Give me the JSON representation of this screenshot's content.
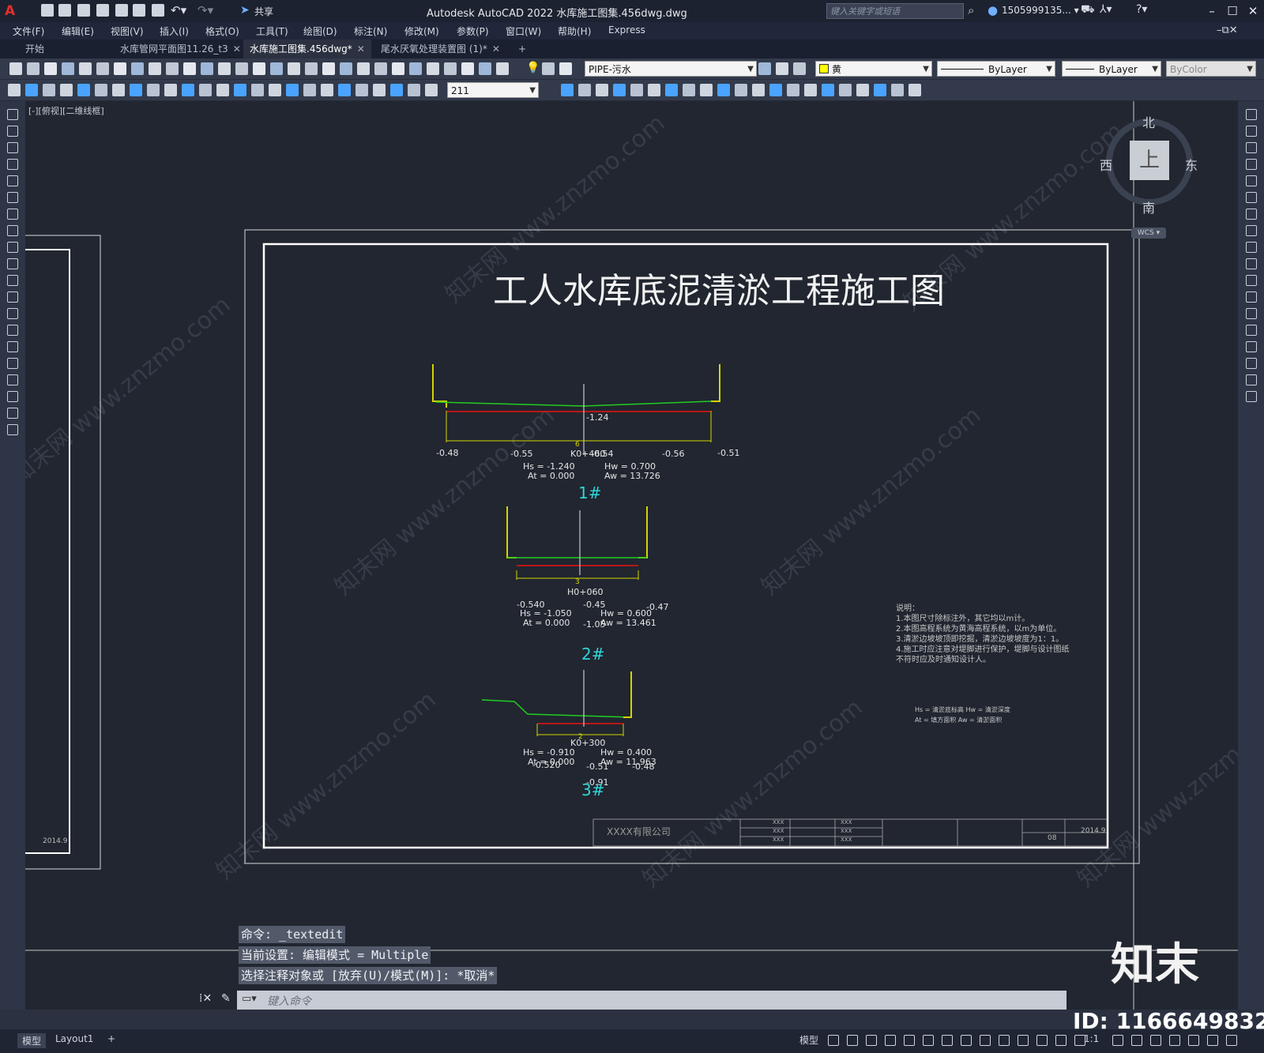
{
  "titlebar": {
    "title": "Autodesk AutoCAD 2022    水库施工图集.456dwg.dwg",
    "share": "共享",
    "search_placeholder": "键入关键字或短语",
    "user": "1505999135... ▾"
  },
  "menu": [
    "文件(F)",
    "编辑(E)",
    "视图(V)",
    "插入(I)",
    "格式(O)",
    "工具(T)",
    "绘图(D)",
    "标注(N)",
    "修改(M)",
    "参数(P)",
    "窗口(W)",
    "帮助(H)",
    "Express"
  ],
  "tabs": [
    {
      "label": "开始",
      "active": false,
      "closable": false
    },
    {
      "label": "水库管网平面图11.26_t3",
      "active": false,
      "closable": true
    },
    {
      "label": "水库施工图集.456dwg*",
      "active": true,
      "closable": true
    },
    {
      "label": "尾水厌氧处理装置图 (1)*",
      "active": false,
      "closable": true
    }
  ],
  "toolbar": {
    "layer": "PIPE-污水",
    "color": "黄",
    "linetype": "ByLayer",
    "lineweight": "ByLayer",
    "plotstyle": "ByColor",
    "dimstyle": "211"
  },
  "viewport_label": "[-][俯视][二维线框]",
  "viewcube": {
    "north": "北",
    "south": "南",
    "east": "东",
    "west": "西",
    "face": "上",
    "wcs": "WCS ▾"
  },
  "drawing": {
    "title": "工人水库底泥清淤工程施工图",
    "sections": [
      {
        "label": "1#",
        "station": "K0+460",
        "center_value": "-1.24",
        "dims": [
          "-0.48",
          "-0.55",
          "-0.54",
          "-0.56",
          "-0.51"
        ],
        "hs": "Hs = -1.240",
        "at": "At = 0.000",
        "hw": "Hw = 0.700",
        "aw": "Aw = 13.726",
        "ruler": "6"
      },
      {
        "label": "2#",
        "station": "H0+060",
        "dims": [
          "-0.540",
          "-0.45",
          "-0.47",
          "-1.05"
        ],
        "hs": "Hs = -1.050",
        "at": "At = 0.000",
        "hw": "Hw = 0.600",
        "aw": "Aw = 13.461",
        "ruler": "3"
      },
      {
        "label": "3#",
        "station": "K0+300",
        "dims": [
          "-0.520",
          "-0.51",
          "-0.48",
          "-0.91"
        ],
        "hs": "Hs = -0.910",
        "at": "At = 0.000",
        "hw": "Hw = 0.400",
        "aw": "Aw = 11.963",
        "ruler": "2"
      }
    ],
    "notes_title": "说明：",
    "notes": [
      "1.本图尺寸除标注外，其它均以m计。",
      "2.本图高程系统为黄海高程系统，以m为单位。",
      "3.清淤边坡坡顶即挖掘，清淤边坡坡度为1：1。",
      "4.施工时应注意对堤脚进行保护，堤脚与设计图纸",
      "不符时应及时通知设计人。"
    ],
    "legend": [
      "Hs = 清淤底标高  Hw = 清淤深度",
      "At = 填方面积    Aw = 清淤面积"
    ],
    "titleblock": {
      "company": "XXXX有限公司",
      "date": "2014.9",
      "sheet": "08",
      "cells": [
        "XXX",
        "XXX",
        "XXX",
        "XXX",
        "XXX",
        "XXX"
      ]
    }
  },
  "command": {
    "history": [
      "命令: _textedit",
      "当前设置: 编辑模式 = Multiple",
      "选择注释对象或 [放弃(U)/模式(M)]: *取消*"
    ],
    "placeholder": "键入命令"
  },
  "status": {
    "model_tab": "模型",
    "layout_tab": "Layout1",
    "mode": "模型",
    "scale": "1:1"
  },
  "overlay": {
    "brand": "知末",
    "id": "ID: 1166649832",
    "watermark": "知末网 www.znzmo.com"
  }
}
